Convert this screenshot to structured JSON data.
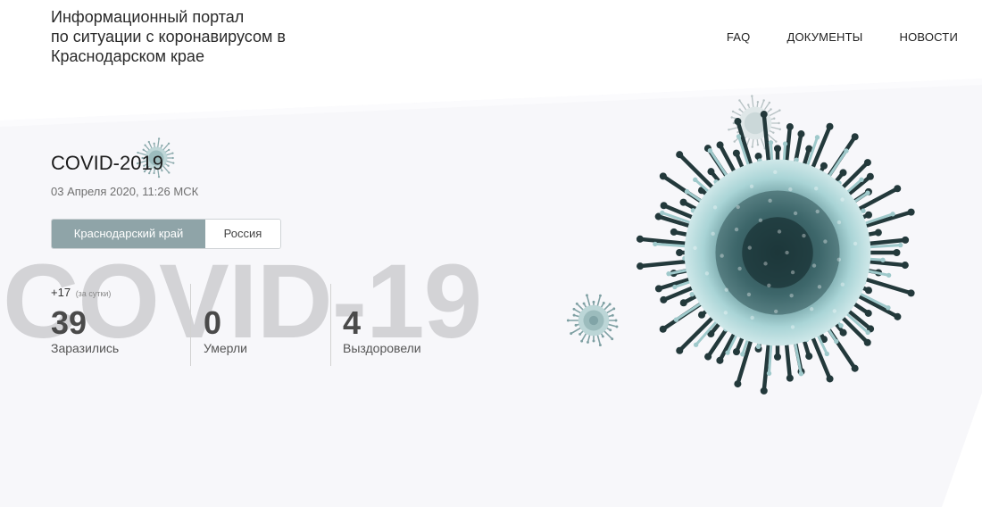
{
  "header": {
    "title_lines": [
      "Информационный портал",
      "по ситуации с коронавирусом в",
      "Краснодарском крае"
    ],
    "nav": [
      "FAQ",
      "ДОКУМЕНТЫ",
      "НОВОСТИ"
    ]
  },
  "hero": {
    "title": "COVID-2019",
    "date": "03 Апреля 2020, 11:26 МСК",
    "watermark": "COVID-19",
    "tabs": [
      {
        "label": "Краснодарский край",
        "active": true
      },
      {
        "label": "Россия",
        "active": false
      }
    ],
    "delta": {
      "value": "+17",
      "note": "(за сутки)"
    },
    "stats": [
      {
        "value": "39",
        "label": "Заразились"
      },
      {
        "value": "0",
        "label": "Умерли"
      },
      {
        "value": "4",
        "label": "Выздоровели"
      }
    ]
  },
  "colors": {
    "accent_tab": "#8fa4a8",
    "virus_body": "#a9d4d6",
    "virus_dark": "#2c4548",
    "watermark": "#d3d3d6"
  },
  "icons": [
    "virus-large-illustration",
    "virus-small-illustration",
    "virus-mini-illustration",
    "virus-title-illustration"
  ]
}
